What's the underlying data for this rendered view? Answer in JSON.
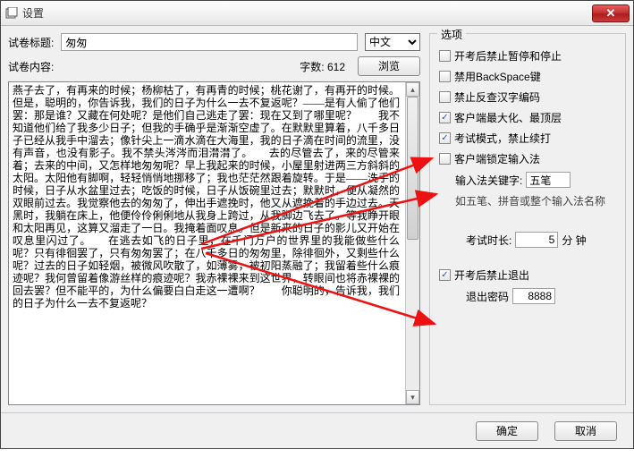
{
  "window": {
    "title": "设置",
    "close": "✕"
  },
  "left": {
    "title_label": "试卷标题:",
    "title_value": "匆匆",
    "lang_options": [
      "中文"
    ],
    "lang_value": "中文",
    "content_label": "试卷内容:",
    "wordcount_label": "字数:",
    "wordcount_value": "612",
    "browse_btn": "浏览",
    "content_text": "燕子去了，有再来的时候；杨柳枯了，有再青的时候；桃花谢了，有再开的时候。但是，聪明的，你告诉我，我们的日子为什么一去不复返呢？——是有人偷了他们罢：那是谁？又藏在何处呢？是他们自己逃走了罢：现在又到了哪里呢？　　我不知道他们给了我多少日子；但我的手确乎是渐渐空虚了。在默默里算着，八千多日子已经从我手中溜去；像针尖上一滴水滴在大海里，我的日子滴在时间的流里，没有声音，也没有影子。我不禁头涔涔而泪潸潸了。　　去的尽管去了，来的尽管来着；去来的中间，又怎样地匆匆呢？早上我起来的时候，小屋里射进两三方斜斜的太阳。太阳他有脚啊，轻轻悄悄地挪移了；我也茫茫然跟着旋转。于是——洗手的时候，日子从水盆里过去；吃饭的时候，日子从饭碗里过去；默默时，便从凝然的双眼前过去。我觉察他去的匆匆了，伸出手遮挽时，他又从遮挽着的手边过去。天黑时，我躺在床上，他便伶伶俐俐地从我身上跨过，从我脚边飞去了。等我睁开眼和太阳再见，这算又溜走了一日。我掩着面叹息。但是新来的日子的影儿又开始在叹息里闪过了。　　在逃去如飞的日子里，在千门万户的世界里的我能做些什么呢？只有徘徊罢了，只有匆匆罢了；在八千多日的匆匆里，除徘徊外，又剩些什么呢？过去的日子如轻烟，被微风吹散了，如薄雾，被初阳蒸融了；我留着些什么痕迹呢？我何曾留着像游丝样的痕迹呢？我赤裸裸来到这世界，转眼间也将赤裸裸的回去罢？但不能平的，为什么偏要白白走这一遭啊？　　你聪明的，告诉我，我们的日子为什么一去不复返呢？"
  },
  "options": {
    "legend": "选项",
    "chk_pause": "开考后禁止暂停和停止",
    "chk_backspace": "禁用BackSpace键",
    "chk_encoding": "禁止反查汉字编码",
    "chk_maximize": "客户端最大化、最顶层",
    "chk_exam_mode": "考试模式，禁止续打",
    "chk_lock_ime": "客户端锁定输入法",
    "ime_kw_label": "输入法关键字:",
    "ime_kw_value": "五笔",
    "ime_hint": "如五笔、拼音或整个输入法名称",
    "duration_label": "考试时长:",
    "duration_value": "5",
    "duration_unit": "分 钟",
    "chk_no_exit": "开考后禁止退出",
    "exit_pw_label": "退出密码",
    "exit_pw_value": "8888"
  },
  "footer": {
    "ok": "确定",
    "cancel": "取消"
  }
}
